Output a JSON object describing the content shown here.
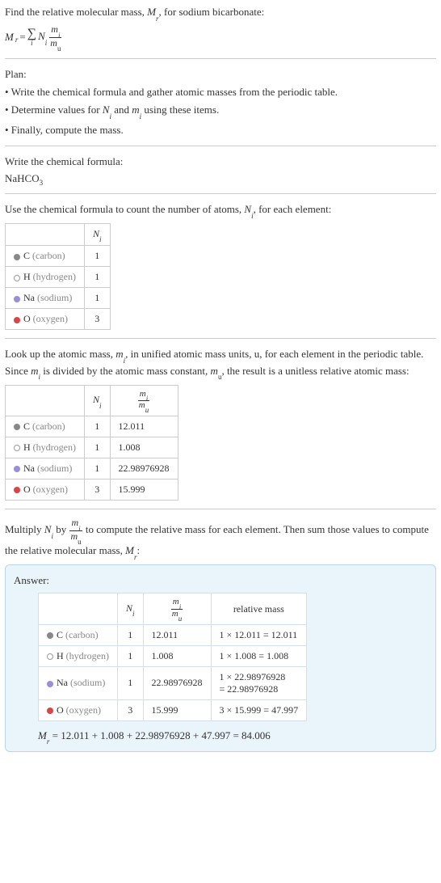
{
  "intro": {
    "line1_pre": "Find the relative molecular mass, ",
    "line1_mid": ", for sodium bicarbonate:",
    "eq_lhs_M": "M",
    "eq_lhs_r": "r",
    "eq_eq": " = ",
    "eq_sigma": "∑",
    "eq_sigma_i": "i",
    "eq_Ni_N": "N",
    "eq_Ni_i": "i",
    "eq_frac_num_m": "m",
    "eq_frac_num_i": "i",
    "eq_frac_den_m": "m",
    "eq_frac_den_u": "u"
  },
  "plan": {
    "title": "Plan:",
    "b1": "• Write the chemical formula and gather atomic masses from the periodic table.",
    "b2_pre": "• Determine values for ",
    "b2_and": " and ",
    "b2_post": " using these items.",
    "b3": "• Finally, compute the mass."
  },
  "formula": {
    "title": "Write the chemical formula:",
    "chem_a": "NaHCO",
    "chem_sub": "3"
  },
  "count": {
    "title_pre": "Use the chemical formula to count the number of atoms, ",
    "title_post": ", for each element:",
    "hdr_Ni_N": "N",
    "hdr_Ni_i": "i",
    "rows": [
      {
        "dot": "dot-c",
        "sym": "C",
        "name": "(carbon)",
        "n": "1"
      },
      {
        "dot": "dot-h",
        "sym": "H",
        "name": "(hydrogen)",
        "n": "1"
      },
      {
        "dot": "dot-na",
        "sym": "Na",
        "name": "(sodium)",
        "n": "1"
      },
      {
        "dot": "dot-o",
        "sym": "O",
        "name": "(oxygen)",
        "n": "3"
      }
    ]
  },
  "lookup": {
    "p1_a": "Look up the atomic mass, ",
    "p1_b": ", in unified atomic mass units, u, for each element in the periodic table. Since ",
    "p1_c": " is divided by the atomic mass constant, ",
    "p1_d": ", the result is a unitless relative atomic mass:",
    "rows": [
      {
        "dot": "dot-c",
        "sym": "C",
        "name": "(carbon)",
        "n": "1",
        "m": "12.011"
      },
      {
        "dot": "dot-h",
        "sym": "H",
        "name": "(hydrogen)",
        "n": "1",
        "m": "1.008"
      },
      {
        "dot": "dot-na",
        "sym": "Na",
        "name": "(sodium)",
        "n": "1",
        "m": "22.98976928"
      },
      {
        "dot": "dot-o",
        "sym": "O",
        "name": "(oxygen)",
        "n": "3",
        "m": "15.999"
      }
    ]
  },
  "multiply": {
    "pre": "Multiply ",
    "mid1": " by ",
    "mid2": " to compute the relative mass for each element. Then sum those values to compute the relative molecular mass, ",
    "post": ":"
  },
  "answer": {
    "label": "Answer:",
    "hdr_rel": "relative mass",
    "rows": [
      {
        "dot": "dot-c",
        "sym": "C",
        "name": "(carbon)",
        "n": "1",
        "m": "12.011",
        "r": "1 × 12.011 = 12.011"
      },
      {
        "dot": "dot-h",
        "sym": "H",
        "name": "(hydrogen)",
        "n": "1",
        "m": "1.008",
        "r": "1 × 1.008 = 1.008"
      },
      {
        "dot": "dot-na",
        "sym": "Na",
        "name": "(sodium)",
        "n": "1",
        "m": "22.98976928",
        "r1": "1 × 22.98976928",
        "r2": "= 22.98976928"
      },
      {
        "dot": "dot-o",
        "sym": "O",
        "name": "(oxygen)",
        "n": "3",
        "m": "15.999",
        "r": "3 × 15.999 = 47.997"
      }
    ],
    "final": " = 12.011 + 1.008 + 22.98976928 + 47.997 = 84.006"
  },
  "chart_data": {
    "type": "table",
    "title": "Relative molecular mass of sodium bicarbonate (NaHCO3)",
    "columns": [
      "element",
      "N_i",
      "m_i/m_u",
      "relative_mass"
    ],
    "rows": [
      {
        "element": "C (carbon)",
        "N_i": 1,
        "m_i/m_u": 12.011,
        "relative_mass": 12.011
      },
      {
        "element": "H (hydrogen)",
        "N_i": 1,
        "m_i/m_u": 1.008,
        "relative_mass": 1.008
      },
      {
        "element": "Na (sodium)",
        "N_i": 1,
        "m_i/m_u": 22.98976928,
        "relative_mass": 22.98976928
      },
      {
        "element": "O (oxygen)",
        "N_i": 3,
        "m_i/m_u": 15.999,
        "relative_mass": 47.997
      }
    ],
    "M_r": 84.006
  }
}
